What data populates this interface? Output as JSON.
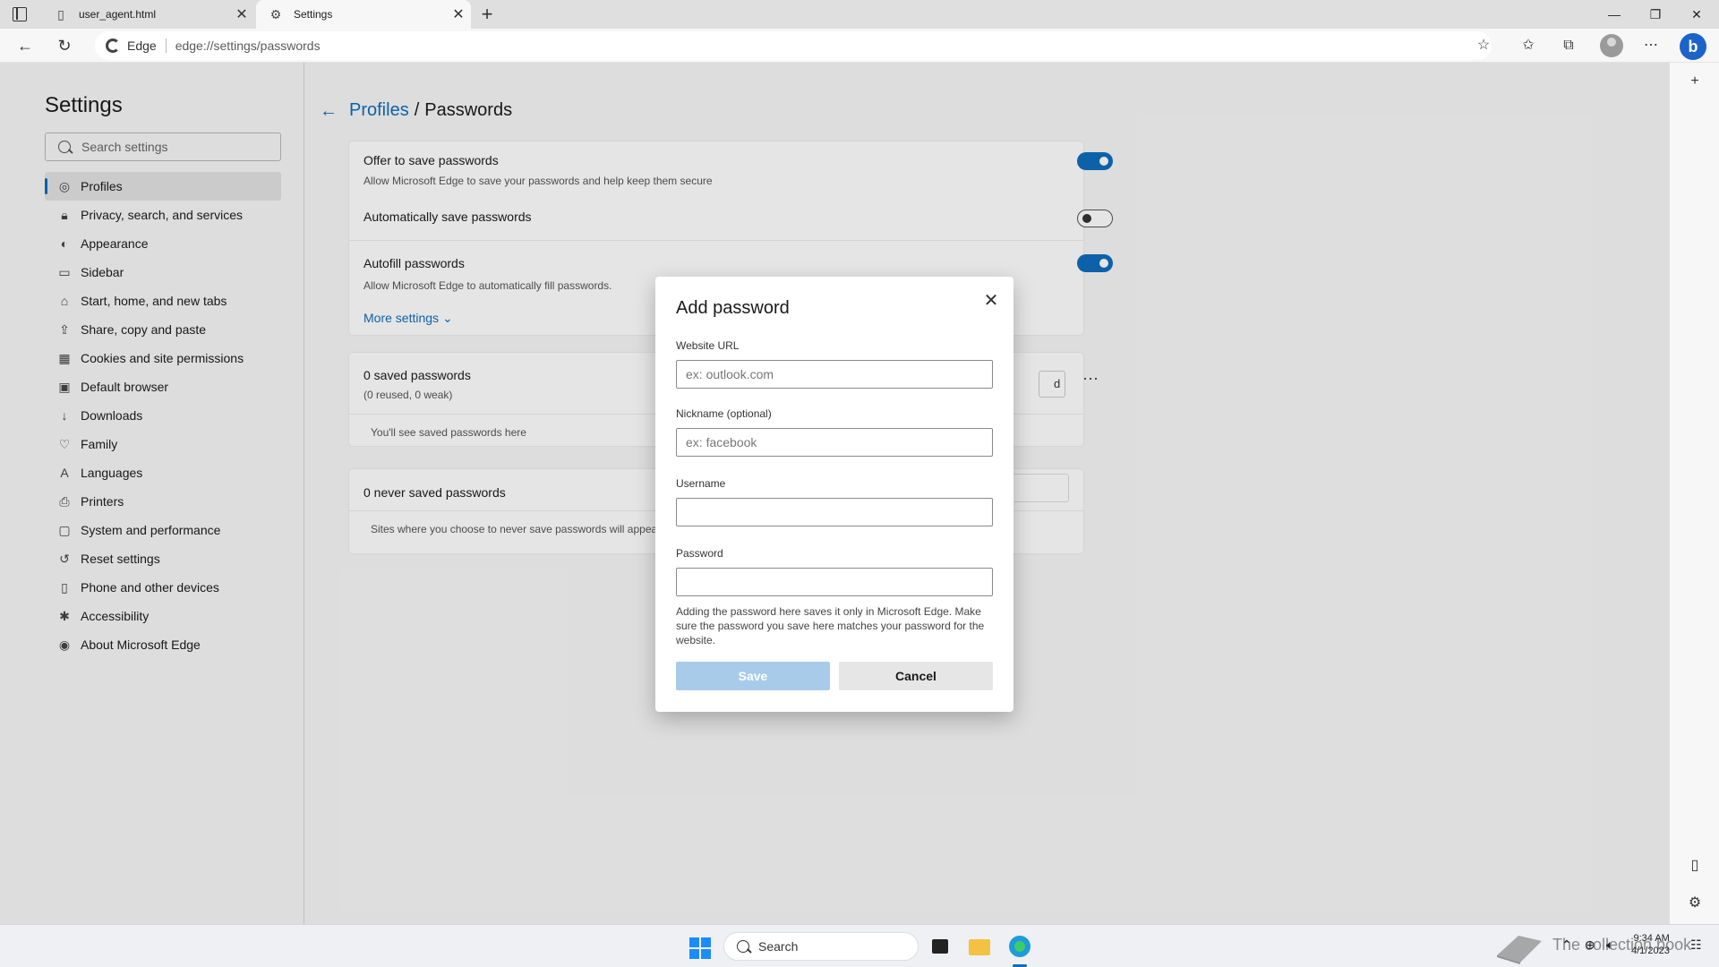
{
  "browser": {
    "tabs": [
      {
        "label": "user_agent.html",
        "icon": "page-icon"
      },
      {
        "label": "Settings",
        "icon": "gear-icon"
      }
    ],
    "address": {
      "site_label": "Edge",
      "url": "edge://settings/passwords"
    }
  },
  "settings_nav": {
    "title": "Settings",
    "search_placeholder": "Search settings",
    "items": [
      {
        "label": "Profiles",
        "icon": "profile-icon"
      },
      {
        "label": "Privacy, search, and services",
        "icon": "lock-icon"
      },
      {
        "label": "Appearance",
        "icon": "appearance-icon"
      },
      {
        "label": "Sidebar",
        "icon": "sidebar-icon"
      },
      {
        "label": "Start, home, and new tabs",
        "icon": "home-icon"
      },
      {
        "label": "Share, copy and paste",
        "icon": "share-icon"
      },
      {
        "label": "Cookies and site permissions",
        "icon": "cookie-icon"
      },
      {
        "label": "Default browser",
        "icon": "browser-icon"
      },
      {
        "label": "Downloads",
        "icon": "download-icon"
      },
      {
        "label": "Family",
        "icon": "family-icon"
      },
      {
        "label": "Languages",
        "icon": "language-icon"
      },
      {
        "label": "Printers",
        "icon": "printer-icon"
      },
      {
        "label": "System and performance",
        "icon": "system-icon"
      },
      {
        "label": "Reset settings",
        "icon": "reset-icon"
      },
      {
        "label": "Phone and other devices",
        "icon": "phone-icon"
      },
      {
        "label": "Accessibility",
        "icon": "accessibility-icon"
      },
      {
        "label": "About Microsoft Edge",
        "icon": "edge-icon"
      }
    ]
  },
  "passwords_page": {
    "breadcrumb_parent": "Profiles",
    "breadcrumb_sep": "/",
    "breadcrumb_current": "Passwords",
    "offer_save": {
      "title": "Offer to save passwords",
      "desc": "Allow Microsoft Edge to save your passwords and help keep them secure",
      "enabled": true
    },
    "auto_save": {
      "title": "Automatically save passwords",
      "enabled": false
    },
    "autofill": {
      "title": "Autofill passwords",
      "desc": "Allow Microsoft Edge to automatically fill passwords.",
      "enabled": true
    },
    "more_settings": "More settings",
    "saved": {
      "title": "0 saved passwords",
      "sub": "(0 reused, 0 weak)",
      "empty": "You'll see saved passwords here",
      "partial_button": "d",
      "more": "···"
    },
    "never_saved": {
      "title": "0 never saved passwords",
      "desc": "Sites where you choose to never save passwords will appear"
    }
  },
  "dialog": {
    "title": "Add password",
    "url_label": "Website URL",
    "url_placeholder": "ex: outlook.com",
    "nickname_label": "Nickname (optional)",
    "nickname_placeholder": "ex: facebook",
    "username_label": "Username",
    "username_value": "",
    "password_label": "Password",
    "password_value": "",
    "note": "Adding the password here saves it only in Microsoft Edge. Make sure the password you save here matches your password for the website.",
    "save_label": "Save",
    "cancel_label": "Cancel"
  },
  "taskbar": {
    "search_label": "Search",
    "watermark_text": "The collection book",
    "time": "9:34 AM",
    "date": "4/1/2023"
  },
  "colors": {
    "accent": "#0f6cbd",
    "save_disabled": "#a8cbea"
  }
}
